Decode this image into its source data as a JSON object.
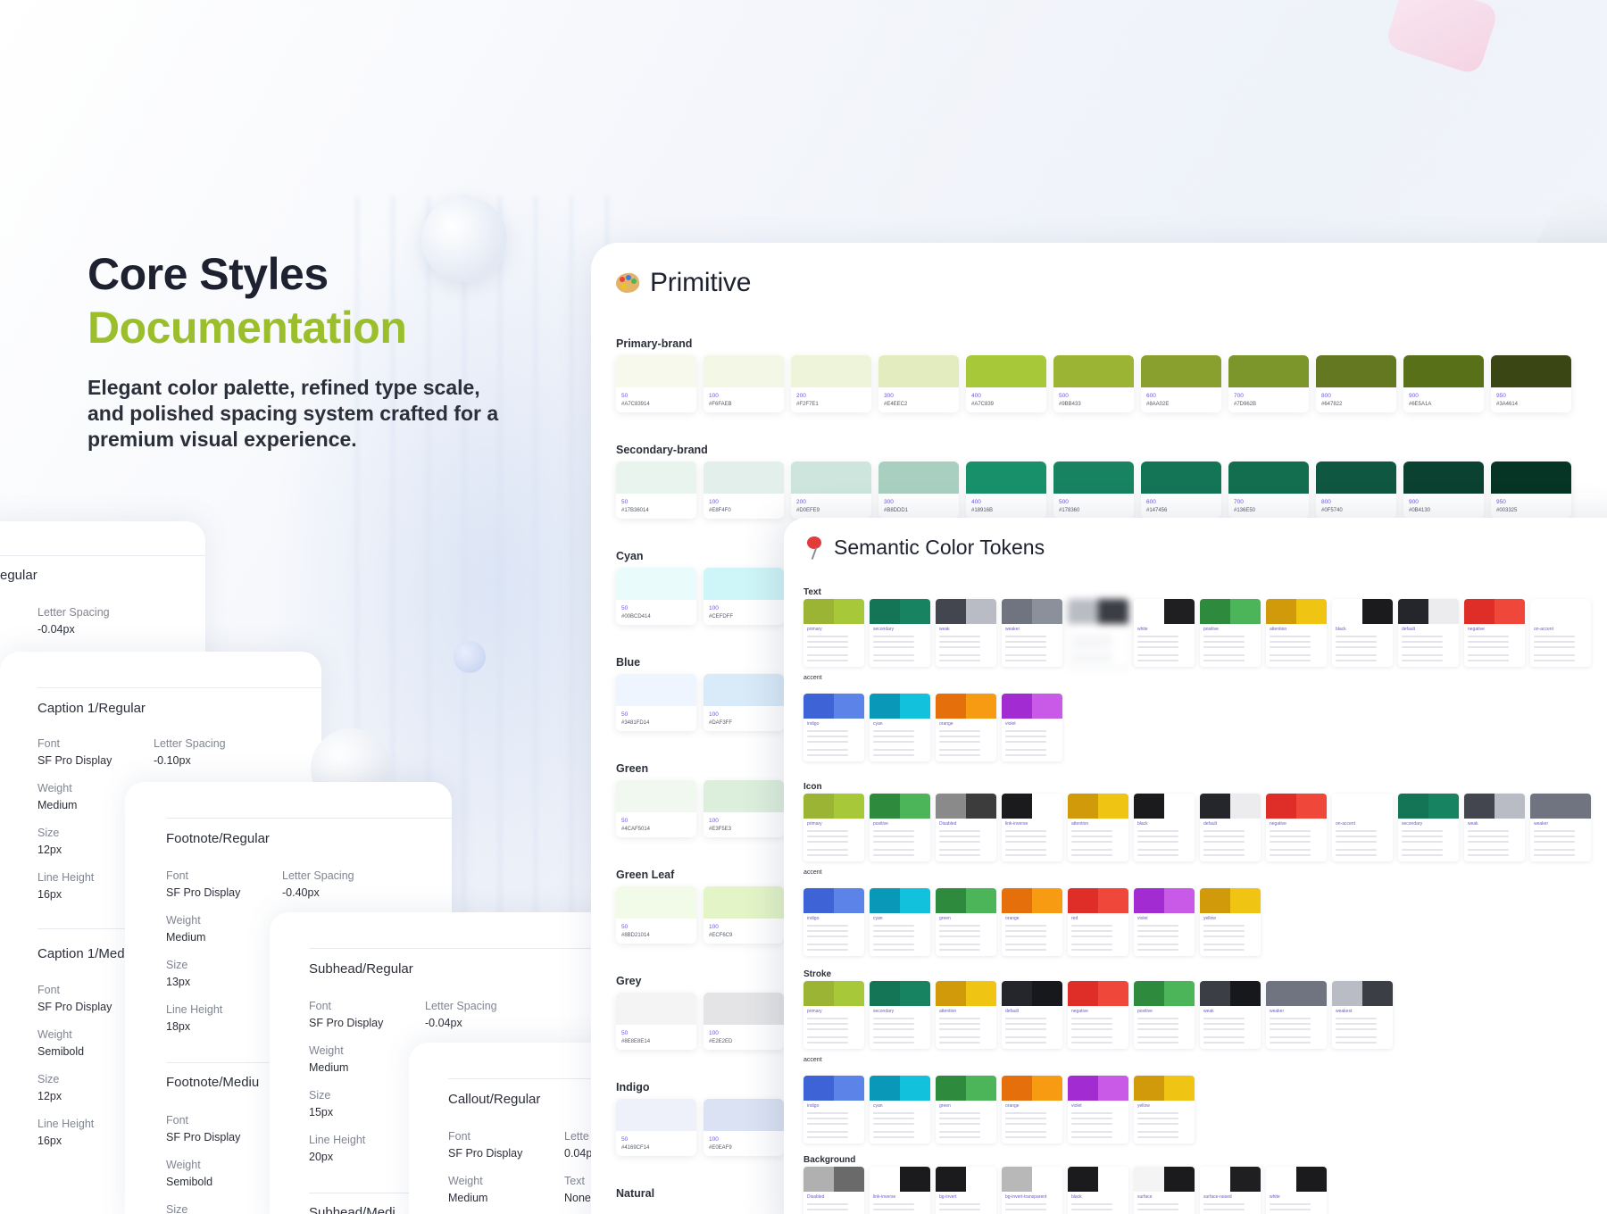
{
  "hero": {
    "title": "Core Styles",
    "accent": "Documentation",
    "description": "Elegant color palette, refined type scale, and polished spacing system crafted for a premium visual experience."
  },
  "type_cards": {
    "c0": {
      "name": "egular",
      "ls_label": "Letter Spacing",
      "ls_value": "-0.04px"
    },
    "c1": {
      "name": "Caption 1/Regular",
      "font_label": "Font",
      "font_value": "SF Pro Display",
      "ls_label": "Letter Spacing",
      "ls_value": "-0.10px",
      "weight_label": "Weight",
      "weight_value": "Medium",
      "size_label": "Size",
      "size_value": "12px",
      "lh_label": "Line Height",
      "lh_value": "16px",
      "next_name": "Caption 1/Med",
      "n_font_label": "Font",
      "n_font_value": "SF Pro Display",
      "n_weight_label": "Weight",
      "n_weight_value": "Semibold",
      "n_size_label": "Size",
      "n_size_value": "12px",
      "n_lh_label": "Line Height",
      "n_lh_value": "16px"
    },
    "c2": {
      "name": "Footnote/Regular",
      "font_label": "Font",
      "font_value": "SF Pro Display",
      "ls_label": "Letter Spacing",
      "ls_value": "-0.40px",
      "weight_label": "Weight",
      "weight_value": "Medium",
      "size_label": "Size",
      "size_value": "13px",
      "lh_label": "Line Height",
      "lh_value": "18px",
      "next_name": "Footnote/Mediu",
      "n_font_label": "Font",
      "n_font_value": "SF Pro Display",
      "n_weight_label": "Weight",
      "n_weight_value": "Semibold",
      "n_size_label": "Size"
    },
    "c3": {
      "name": "Subhead/Regular",
      "font_label": "Font",
      "font_value": "SF Pro Display",
      "ls_label": "Letter Spacing",
      "ls_value": "-0.04px",
      "weight_label": "Weight",
      "weight_value": "Medium",
      "size_label": "Size",
      "size_value": "15px",
      "lh_label": "Line Height",
      "lh_value": "20px",
      "next_name": "Subhead/Medi"
    },
    "c4": {
      "name": "Callout/Regular",
      "font_label": "Font",
      "font_value": "SF Pro Display",
      "ls_label": "Lette",
      "ls_value": "0.04p",
      "weight_label": "Weight",
      "weight_value": "Medium",
      "text_label": "Text",
      "text_value": "None"
    }
  },
  "primitive": {
    "title": "Primitive",
    "groups": [
      {
        "label": "Primary-brand",
        "swatches": [
          {
            "step": "50",
            "hex": "#A7C83914",
            "color": "#f6f9ec"
          },
          {
            "step": "100",
            "hex": "#F6FAEB",
            "color": "#f3f7e6"
          },
          {
            "step": "200",
            "hex": "#F2F7E1",
            "color": "#eef4da"
          },
          {
            "step": "300",
            "hex": "#E4EEC2",
            "color": "#e2ecbe"
          },
          {
            "step": "400",
            "hex": "#A7C839",
            "color": "#a7c839"
          },
          {
            "step": "500",
            "hex": "#9BB433",
            "color": "#9bb433"
          },
          {
            "step": "600",
            "hex": "#8AA02E",
            "color": "#8aa02e"
          },
          {
            "step": "700",
            "hex": "#7D962B",
            "color": "#7d962b"
          },
          {
            "step": "800",
            "hex": "#647822",
            "color": "#647822"
          },
          {
            "step": "900",
            "hex": "#6E5A1A",
            "color": "#587018"
          },
          {
            "step": "950",
            "hex": "#3A4614",
            "color": "#3a4614"
          }
        ]
      },
      {
        "label": "Secondary-brand",
        "swatches": [
          {
            "step": "50",
            "hex": "#17B36014",
            "color": "#eaf4ef"
          },
          {
            "step": "100",
            "hex": "#E8F4F0",
            "color": "#e3efea"
          },
          {
            "step": "200",
            "hex": "#D0EFE9",
            "color": "#cde5dc"
          },
          {
            "step": "300",
            "hex": "#B8DDD1",
            "color": "#a9cfc0"
          },
          {
            "step": "400",
            "hex": "#18916B",
            "color": "#18916b"
          },
          {
            "step": "500",
            "hex": "#178360",
            "color": "#178360"
          },
          {
            "step": "600",
            "hex": "#147456",
            "color": "#147456"
          },
          {
            "step": "700",
            "hex": "#136E50",
            "color": "#136e50"
          },
          {
            "step": "800",
            "hex": "#0F5740",
            "color": "#0f5740"
          },
          {
            "step": "900",
            "hex": "#0B4130",
            "color": "#0b4130"
          },
          {
            "step": "950",
            "hex": "#003325",
            "color": "#063525"
          }
        ]
      },
      {
        "label": "Cyan",
        "swatches": [
          {
            "step": "50",
            "hex": "#00BCD414",
            "color": "#eafbfc"
          },
          {
            "step": "100",
            "hex": "#CEFDFF",
            "color": "#cef5f7"
          }
        ]
      },
      {
        "label": "Blue",
        "swatches": [
          {
            "step": "50",
            "hex": "#3481FD14",
            "color": "#eef5fe"
          },
          {
            "step": "100",
            "hex": "#DAF3FF",
            "color": "#d9eaf8"
          }
        ]
      },
      {
        "label": "Green",
        "swatches": [
          {
            "step": "50",
            "hex": "#4CAF5014",
            "color": "#f0f8f0"
          },
          {
            "step": "100",
            "hex": "#E3F5E3",
            "color": "#dcefdc"
          }
        ]
      },
      {
        "label": "Green Leaf",
        "swatches": [
          {
            "step": "50",
            "hex": "#8BD21014",
            "color": "#f2fae8"
          },
          {
            "step": "100",
            "hex": "#ECF6C9",
            "color": "#e3f4c6"
          }
        ]
      },
      {
        "label": "Grey",
        "swatches": [
          {
            "step": "50",
            "hex": "#8E8E8E14",
            "color": "#f4f4f4"
          },
          {
            "step": "100",
            "hex": "#E2E2ED",
            "color": "#e4e4e6"
          }
        ]
      },
      {
        "label": "Indigo",
        "swatches": [
          {
            "step": "50",
            "hex": "#4169CF14",
            "color": "#eef1fa"
          },
          {
            "step": "100",
            "hex": "#E0EAF9",
            "color": "#dbe2f3"
          }
        ]
      },
      {
        "label": "Natural",
        "swatches": []
      }
    ]
  },
  "semantic": {
    "title": "Semantic Color Tokens",
    "sections": [
      {
        "label": "Text",
        "rows": [
          {
            "sublabel": "",
            "tokens": [
              {
                "name": "primary",
                "c1": "#9bb433",
                "c2": "#a7c839"
              },
              {
                "name": "secondary",
                "c1": "#147456",
                "c2": "#178360"
              },
              {
                "name": "weak",
                "c1": "#44464f",
                "c2": "#b9bcc4"
              },
              {
                "name": "weaker",
                "c1": "#6f7480",
                "c2": "#8b909b"
              },
              {
                "name": "",
                "c1": "#b9bcc4",
                "c2": "#3b3d44",
                "blur": true
              },
              {
                "name": "white",
                "c1": "#ffffff",
                "c2": "#1f1f22"
              },
              {
                "name": "positive",
                "c1": "#2e8b3e",
                "c2": "#4cb55a"
              },
              {
                "name": "attention",
                "c1": "#d19a0a",
                "c2": "#f0c412"
              },
              {
                "name": "black",
                "c1": "#ffffff",
                "c2": "#1b1b1d"
              },
              {
                "name": "default",
                "c1": "#24262c",
                "c2": "#ececee"
              },
              {
                "name": "negative",
                "c1": "#df2e27",
                "c2": "#f0473b"
              },
              {
                "name": "on-accent",
                "c1": "#ffffff",
                "c2": "#ffffff"
              }
            ]
          },
          {
            "sublabel": "accent",
            "tokens": [
              {
                "name": "indigo",
                "c1": "#3d63d6",
                "c2": "#5c84e8"
              },
              {
                "name": "cyan",
                "c1": "#0a98b8",
                "c2": "#12c2dd"
              },
              {
                "name": "orange",
                "c1": "#e5700b",
                "c2": "#f79b13"
              },
              {
                "name": "violet",
                "c1": "#a32bd2",
                "c2": "#c95ae8"
              }
            ]
          }
        ]
      },
      {
        "label": "Icon",
        "rows": [
          {
            "sublabel": "",
            "tokens": [
              {
                "name": "primary",
                "c1": "#9bb433",
                "c2": "#a7c839"
              },
              {
                "name": "positive",
                "c1": "#2e8b3e",
                "c2": "#4cb55a"
              },
              {
                "name": "Disabled",
                "c1": "#8a8a8a",
                "c2": "#3c3c3c"
              },
              {
                "name": "link-inverse",
                "c1": "#1b1b1d",
                "c2": "#ffffff"
              },
              {
                "name": "attention",
                "c1": "#d19a0a",
                "c2": "#f0c412"
              },
              {
                "name": "black",
                "c1": "#1b1b1d",
                "c2": "#ffffff"
              },
              {
                "name": "default",
                "c1": "#24262c",
                "c2": "#ececee"
              },
              {
                "name": "negative",
                "c1": "#df2e27",
                "c2": "#f0473b"
              },
              {
                "name": "on-accent",
                "c1": "#ffffff",
                "c2": "#ffffff"
              },
              {
                "name": "secondary",
                "c1": "#147456",
                "c2": "#178360"
              },
              {
                "name": "weak",
                "c1": "#44464f",
                "c2": "#b9bcc4"
              },
              {
                "name": "weaker",
                "c1": "#6f7480",
                "c2": "#6f7480"
              }
            ]
          },
          {
            "sublabel": "accent",
            "tokens": [
              {
                "name": "indigo",
                "c1": "#3d63d6",
                "c2": "#5c84e8"
              },
              {
                "name": "cyan",
                "c1": "#0a98b8",
                "c2": "#12c2dd"
              },
              {
                "name": "green",
                "c1": "#2e8b3e",
                "c2": "#4cb55a"
              },
              {
                "name": "orange",
                "c1": "#e5700b",
                "c2": "#f79b13"
              },
              {
                "name": "red",
                "c1": "#df2e27",
                "c2": "#f0473b"
              },
              {
                "name": "violet",
                "c1": "#a32bd2",
                "c2": "#c95ae8"
              },
              {
                "name": "yellow",
                "c1": "#d19a0a",
                "c2": "#f0c412"
              }
            ]
          }
        ]
      },
      {
        "label": "Stroke",
        "rows": [
          {
            "sublabel": "",
            "tokens": [
              {
                "name": "primary",
                "c1": "#9bb433",
                "c2": "#a7c839"
              },
              {
                "name": "secondary",
                "c1": "#147456",
                "c2": "#178360"
              },
              {
                "name": "attention",
                "c1": "#d19a0a",
                "c2": "#f0c412"
              },
              {
                "name": "default",
                "c1": "#24262c",
                "c2": "#17181c"
              },
              {
                "name": "negative",
                "c1": "#df2e27",
                "c2": "#f0473b"
              },
              {
                "name": "positive",
                "c1": "#2e8b3e",
                "c2": "#4cb55a"
              },
              {
                "name": "weak",
                "c1": "#3c3e46",
                "c2": "#17181c"
              },
              {
                "name": "weaker",
                "c1": "#6f7480",
                "c2": "#6f7480"
              },
              {
                "name": "weakest",
                "c1": "#b9bcc4",
                "c2": "#3c3e46"
              }
            ]
          },
          {
            "sublabel": "accent",
            "tokens": [
              {
                "name": "indigo",
                "c1": "#3d63d6",
                "c2": "#5c84e8"
              },
              {
                "name": "cyan",
                "c1": "#0a98b8",
                "c2": "#12c2dd"
              },
              {
                "name": "green",
                "c1": "#2e8b3e",
                "c2": "#4cb55a"
              },
              {
                "name": "orange",
                "c1": "#e5700b",
                "c2": "#f79b13"
              },
              {
                "name": "violet",
                "c1": "#a32bd2",
                "c2": "#c95ae8"
              },
              {
                "name": "yellow",
                "c1": "#d19a0a",
                "c2": "#f0c412"
              }
            ]
          }
        ]
      },
      {
        "label": "Background",
        "rows": [
          {
            "sublabel": "",
            "tokens": [
              {
                "name": "Disabled",
                "c1": "#b0b0b0",
                "c2": "#6a6a6a"
              },
              {
                "name": "link-inverse",
                "c1": "#ffffff",
                "c2": "#1b1b1d"
              },
              {
                "name": "bg-invert",
                "c1": "#1b1b1d",
                "c2": "#ffffff"
              },
              {
                "name": "bg-invert-transparent",
                "c1": "#b8b8b8",
                "c2": "#ffffff"
              },
              {
                "name": "black",
                "c1": "#1b1b1d",
                "c2": "#ffffff"
              },
              {
                "name": "surface",
                "c1": "#f4f4f5",
                "c2": "#1b1b1d"
              },
              {
                "name": "surface-raised",
                "c1": "#ffffff",
                "c2": "#1f1f22"
              },
              {
                "name": "white",
                "c1": "#ffffff",
                "c2": "#1b1b1d"
              }
            ]
          }
        ]
      }
    ]
  },
  "icons": {
    "primitive": "palette-icon",
    "semantic": "pushpin-icon"
  }
}
